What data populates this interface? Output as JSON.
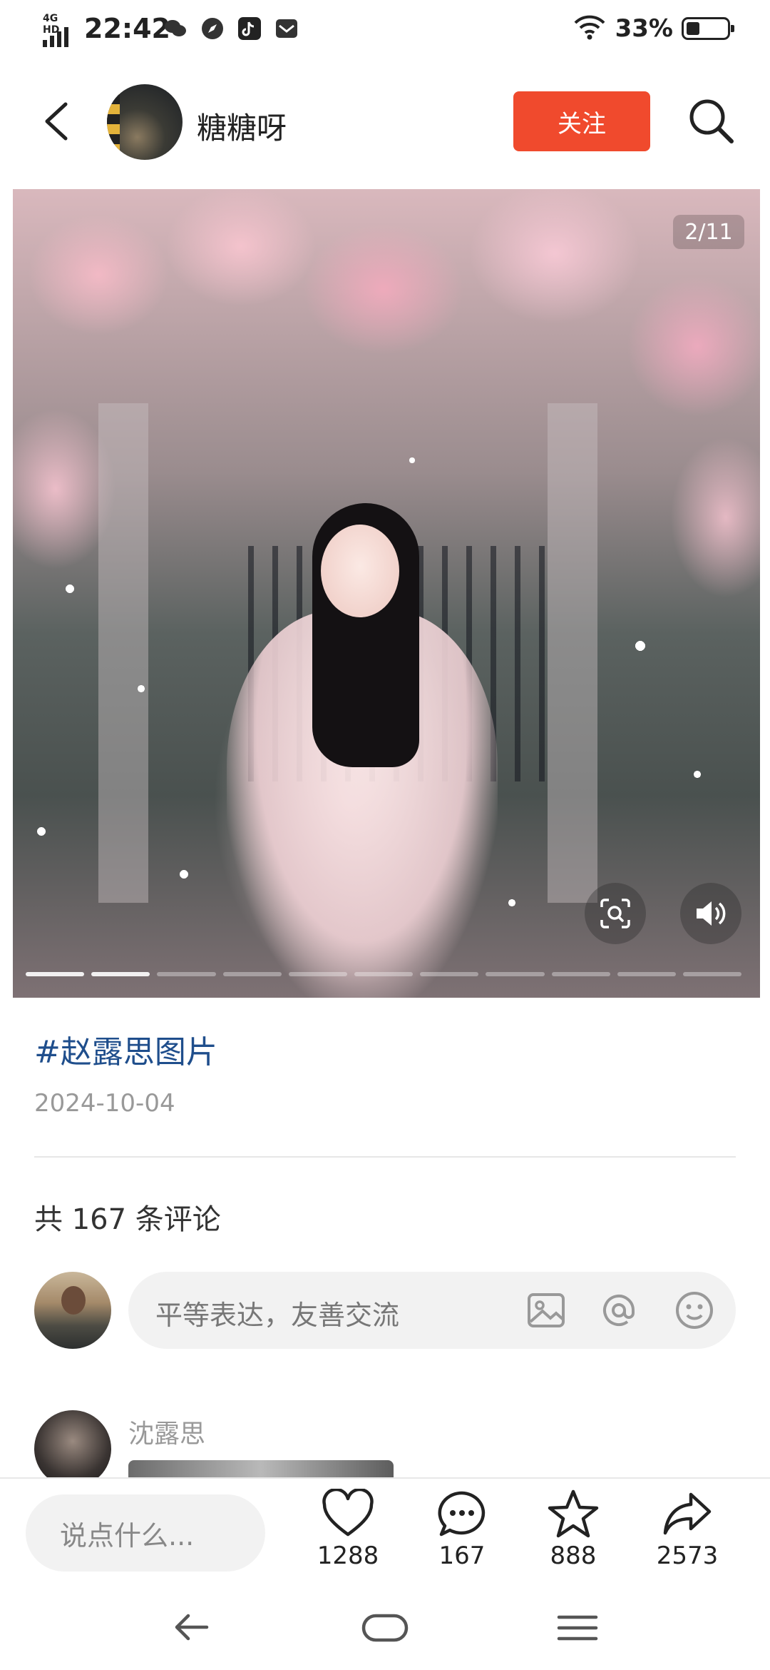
{
  "status_bar": {
    "network": "4G HD",
    "time": "22:42",
    "app_icons": [
      "wechat-icon",
      "compass-icon",
      "tiktok-icon",
      "mail-icon"
    ],
    "battery_percent": "33%",
    "battery_level": 0.33
  },
  "header": {
    "author_name": "糖糖呀",
    "follow_label": "关注"
  },
  "viewer": {
    "page_indicator": "2/11",
    "current_page": 2,
    "total_pages": 11
  },
  "post": {
    "hashtag": "#赵露思图片",
    "date": "2024-10-04"
  },
  "comments": {
    "count_label": "共 167 条评论",
    "input_placeholder": "平等表达，友善交流",
    "first_comment": {
      "author": "沈露思"
    }
  },
  "bottom_bar": {
    "say_placeholder": "说点什么...",
    "likes": "1288",
    "comments": "167",
    "favorites": "888",
    "shares": "2573"
  },
  "colors": {
    "accent": "#f04a2d",
    "hashtag": "#1f4e8c"
  }
}
